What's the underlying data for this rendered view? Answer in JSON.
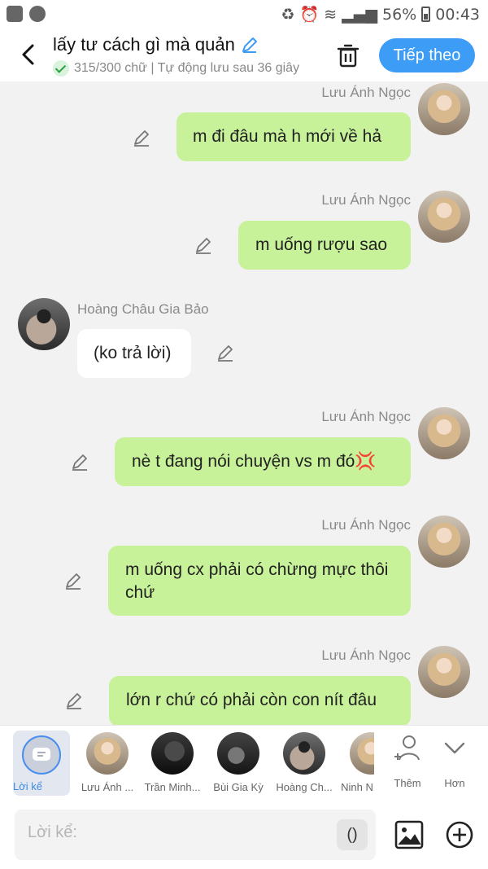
{
  "status_bar": {
    "battery": "56%",
    "time": "00:43"
  },
  "header": {
    "title": "lấy tư cách gì mà quản",
    "subtitle": "315/300 chữ | Tự động lưu sau 36 giây",
    "next_label": "Tiếp theo"
  },
  "messages": [
    {
      "sender": "Lưu Ánh Ngọc",
      "text": "m đi đâu mà h mới về hả",
      "side": "right"
    },
    {
      "sender": "Lưu Ánh Ngọc",
      "text": "m uống rượu sao",
      "side": "right"
    },
    {
      "sender": "Hoàng Châu Gia Bảo",
      "text": "(ko trả lời)",
      "side": "left"
    },
    {
      "sender": "Lưu Ánh Ngọc",
      "text": "nè t đang nói chuyện vs m đó💢",
      "side": "right"
    },
    {
      "sender": "Lưu Ánh Ngọc",
      "text": "m uống cx phải có chừng mực thôi chứ",
      "side": "right"
    },
    {
      "sender": "Lưu Ánh Ngọc",
      "text": "lớn r chứ có phải còn con nít đâu",
      "side": "right"
    }
  ],
  "characters": [
    {
      "label": "Lời kể",
      "selected": true
    },
    {
      "label": "Lưu Ánh ..."
    },
    {
      "label": "Trần Minh..."
    },
    {
      "label": "Bùi Gia Kỳ"
    },
    {
      "label": "Hoàng Ch..."
    },
    {
      "label": "Ninh N"
    }
  ],
  "actions": {
    "add_label": "Thêm",
    "more_label": "Hơn"
  },
  "composer": {
    "placeholder": "Lời kể:",
    "paren_label": "()"
  },
  "colors": {
    "accent": "#3d9cf5",
    "bubble_right": "#c8f29a",
    "bubble_left": "#ffffff"
  }
}
